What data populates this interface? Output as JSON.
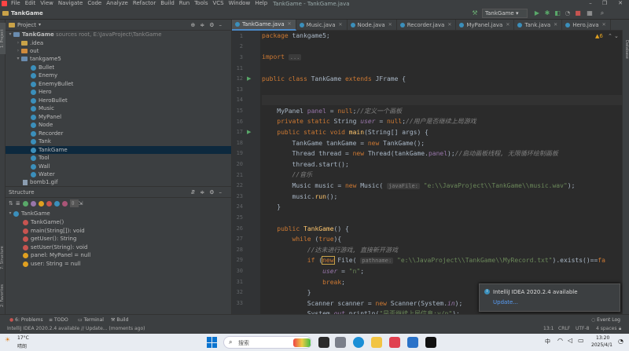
{
  "window": {
    "title": "TankGame - TankGame.java"
  },
  "menu": [
    "File",
    "Edit",
    "View",
    "Navigate",
    "Code",
    "Analyze",
    "Refactor",
    "Build",
    "Run",
    "Tools",
    "VCS",
    "Window",
    "Help"
  ],
  "toolbar": {
    "project_name": "TankGame",
    "run_config": "TankGame"
  },
  "left_strip": {
    "project": "1: Project",
    "structure": "7: Structure",
    "favorites": "2: Favorites"
  },
  "right_strip": {
    "database": "Database"
  },
  "project_panel": {
    "header": "Project",
    "root_name": "TankGame",
    "root_path": "sources root,  E:\\JavaProject\\TankGame",
    "items": [
      ".idea",
      "out",
      "tankgame5",
      "Bullet",
      "Enemy",
      "EnemyBullet",
      "Hero",
      "HeroBullet",
      "Music",
      "MyPanel",
      "Node",
      "Recorder",
      "Tank",
      "TankGame",
      "Tool",
      "Wall",
      "Water",
      "bomb1.gif"
    ]
  },
  "structure_panel": {
    "header": "Structure",
    "root": "TankGame",
    "items": [
      "TankGame()",
      "main(String[]): void",
      "getUser(): String",
      "setUser(String): void",
      "panel: MyPanel = null",
      "user: String = null"
    ]
  },
  "editor": {
    "tabs": [
      "TankGame.java",
      "Music.java",
      "Node.java",
      "Recorder.java",
      "MyPanel.java",
      "Tank.java",
      "Hero.java"
    ],
    "warnings": "6",
    "line_numbers": [
      "1",
      "2",
      "3",
      "11",
      "12",
      "13",
      "14",
      "15",
      "16",
      "17",
      "18",
      "19",
      "20",
      "21",
      "22",
      "23",
      "24",
      "25",
      "26",
      "27",
      "28",
      "29",
      "30",
      "31",
      "32",
      "33",
      "34"
    ],
    "hint_javafile": "javaFile:",
    "hint_pathname": "pathname:"
  },
  "status": {
    "tabs": {
      "problems": "6: Problems",
      "todo": "TODO",
      "terminal": "Terminal",
      "build": "Build",
      "event_log": "Event Log"
    },
    "message": "IntelliJ IDEA 2020.2.4 available // Update... (moments ago)",
    "position": "13:1",
    "line_sep": "CRLF",
    "encoding": "UTF-8",
    "indent": "4 spaces"
  },
  "notification": {
    "title": "IntelliJ IDEA 2020.2.4 available",
    "link": "Update..."
  },
  "taskbar": {
    "temp": "17°C",
    "weather": "晴朗",
    "search": "搜索",
    "ime": "中",
    "time": "13:20",
    "date": "2025/4/1"
  }
}
